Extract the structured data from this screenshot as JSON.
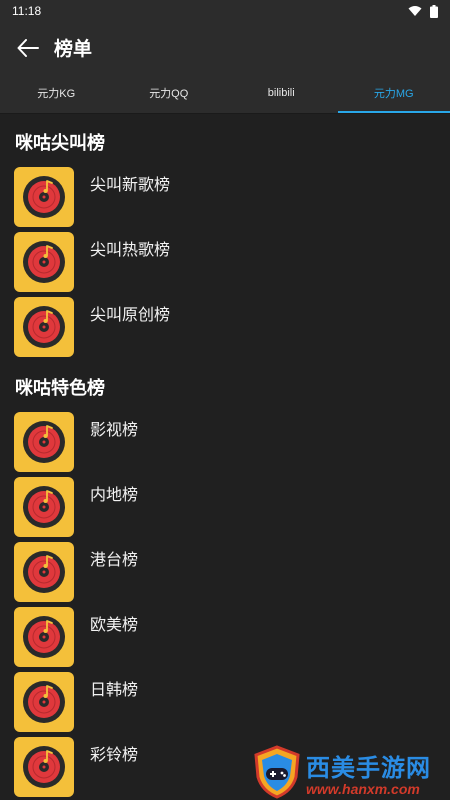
{
  "status": {
    "time": "11:18"
  },
  "header": {
    "title": "榜单"
  },
  "tabs": [
    {
      "label": "元力KG",
      "active": false
    },
    {
      "label": "元力QQ",
      "active": false
    },
    {
      "label": "bilibili",
      "active": false
    },
    {
      "label": "元力MG",
      "active": true
    }
  ],
  "sections": [
    {
      "title": "咪咕尖叫榜",
      "items": [
        "尖叫新歌榜",
        "尖叫热歌榜",
        "尖叫原创榜"
      ]
    },
    {
      "title": "咪咕特色榜",
      "items": [
        "影视榜",
        "内地榜",
        "港台榜",
        "欧美榜",
        "日韩榜",
        "彩铃榜"
      ]
    }
  ],
  "watermark": {
    "name": "西美手游网",
    "url": "www.hanxm.com"
  },
  "colors": {
    "accent": "#29a7e8",
    "cover": "#f4c03a",
    "disc": "#e0383c",
    "background": "#202020",
    "bar": "#2c2c2c"
  }
}
